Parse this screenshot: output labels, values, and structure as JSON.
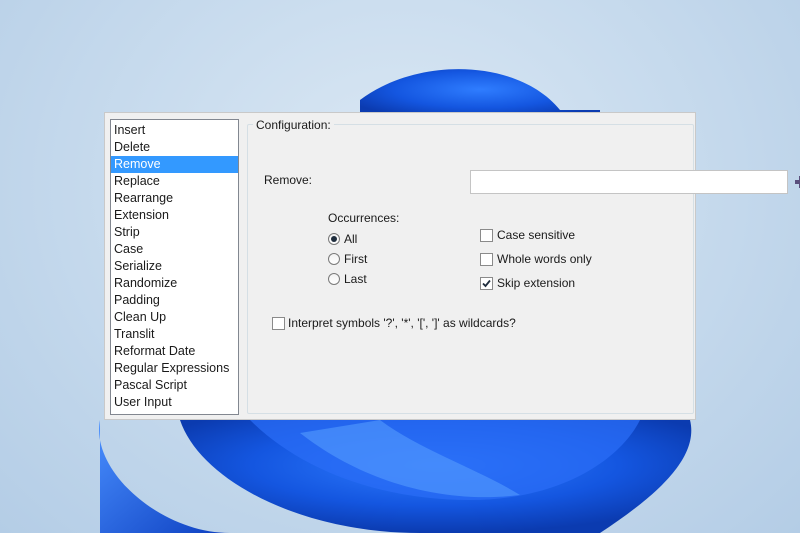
{
  "rule_list": {
    "items": [
      {
        "label": "Insert"
      },
      {
        "label": "Delete"
      },
      {
        "label": "Remove",
        "selected": true
      },
      {
        "label": "Replace"
      },
      {
        "label": "Rearrange"
      },
      {
        "label": "Extension"
      },
      {
        "label": "Strip"
      },
      {
        "label": "Case"
      },
      {
        "label": "Serialize"
      },
      {
        "label": "Randomize"
      },
      {
        "label": "Padding"
      },
      {
        "label": "Clean Up"
      },
      {
        "label": "Translit"
      },
      {
        "label": "Reformat Date"
      },
      {
        "label": "Regular Expressions"
      },
      {
        "label": "Pascal Script"
      },
      {
        "label": "User Input"
      }
    ]
  },
  "config": {
    "title": "Configuration:",
    "remove_label": "Remove:",
    "remove_value": "",
    "add_icon": "plus-icon",
    "occurrences_label": "Occurrences:",
    "occurrences": [
      {
        "label": "All",
        "checked": true
      },
      {
        "label": "First",
        "checked": false
      },
      {
        "label": "Last",
        "checked": false
      }
    ],
    "options": [
      {
        "label": "Case sensitive",
        "checked": false
      },
      {
        "label": "Whole words only",
        "checked": false
      },
      {
        "label": "Skip extension",
        "checked": true
      }
    ],
    "wildcards": {
      "label": "Interpret symbols '?', '*', '[', ']' as wildcards?",
      "checked": false
    }
  },
  "colors": {
    "selection": "#3399ff",
    "accent_plus": "#5a4f7d"
  }
}
